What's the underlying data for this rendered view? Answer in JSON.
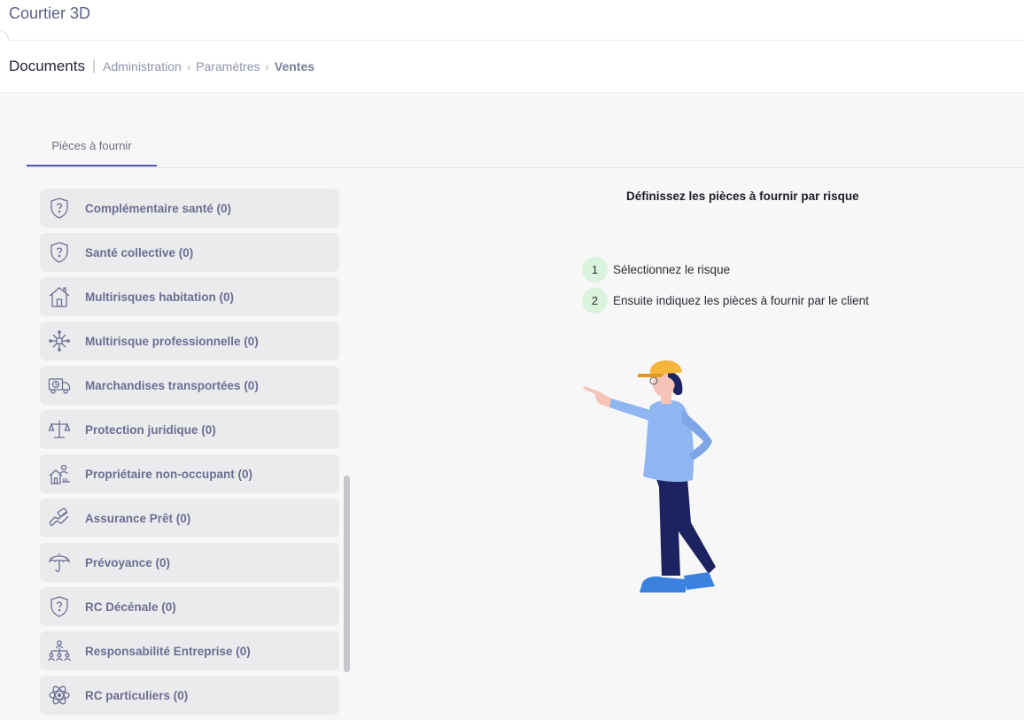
{
  "app": {
    "title": "Courtier 3D"
  },
  "header": {
    "section": "Documents",
    "separator": "|",
    "breadcrumb": [
      "Administration",
      "Paramètres"
    ],
    "current": "Ventes",
    "chevron": "›"
  },
  "tabs": [
    {
      "label": "Pièces à fournir",
      "active": true
    }
  ],
  "risks": [
    {
      "label": "Complémentaire santé (0)",
      "icon": "shield-question-icon"
    },
    {
      "label": "Santé collective (0)",
      "icon": "shield-question-icon"
    },
    {
      "label": "Multirisques habitation (0)",
      "icon": "house-icon"
    },
    {
      "label": "Multirisque professionnelle (0)",
      "icon": "network-icon"
    },
    {
      "label": "Marchandises transportées (0)",
      "icon": "truck-icon"
    },
    {
      "label": "Protection juridique (0)",
      "icon": "scales-icon"
    },
    {
      "label": "Propriétaire non-occupant (0)",
      "icon": "owner-house-icon"
    },
    {
      "label": "Assurance Prêt (0)",
      "icon": "handshake-icon"
    },
    {
      "label": "Prévoyance (0)",
      "icon": "umbrella-icon"
    },
    {
      "label": "RC Décénale (0)",
      "icon": "shield-question-icon"
    },
    {
      "label": "Responsabilité Entreprise (0)",
      "icon": "org-chart-icon"
    },
    {
      "label": "RC particuliers (0)",
      "icon": "atom-icon"
    }
  ],
  "panel": {
    "title": "Définissez les pièces à fournir par risque",
    "steps": [
      {
        "num": "1",
        "text": "Sélectionnez le risque"
      },
      {
        "num": "2",
        "text": "Ensuite indiquez les pièces à fournir par le client"
      }
    ]
  },
  "colors": {
    "accent": "#4c55b3",
    "item_bg": "#ebebee",
    "item_text": "#6a6e92",
    "step_bg": "#daf3dc"
  }
}
